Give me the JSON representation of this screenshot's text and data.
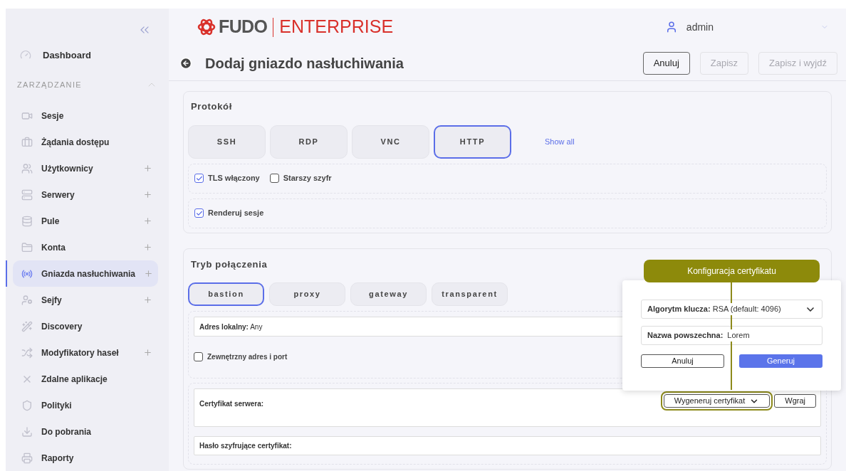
{
  "sidebar": {
    "dashboard": "Dashboard",
    "section": {
      "title": "ZARZĄDZANIE",
      "expanded": true
    },
    "items": [
      {
        "label": "Sesje",
        "addable": false,
        "selected": false
      },
      {
        "label": "Żądania dostępu",
        "addable": false,
        "selected": false
      },
      {
        "label": "Użytkownicy",
        "addable": true,
        "selected": false
      },
      {
        "label": "Serwery",
        "addable": true,
        "selected": false
      },
      {
        "label": "Pule",
        "addable": true,
        "selected": false
      },
      {
        "label": "Konta",
        "addable": true,
        "selected": false
      },
      {
        "label": "Gniazda nasłuchiwania",
        "addable": true,
        "selected": true
      },
      {
        "label": "Sejfy",
        "addable": true,
        "selected": false
      },
      {
        "label": "Discovery",
        "addable": false,
        "selected": false
      },
      {
        "label": "Modyfikatory haseł",
        "addable": true,
        "selected": false
      },
      {
        "label": "Zdalne aplikacje",
        "addable": false,
        "selected": false
      },
      {
        "label": "Polityki",
        "addable": false,
        "selected": false
      },
      {
        "label": "Do pobrania",
        "addable": false,
        "selected": false
      },
      {
        "label": "Raporty",
        "addable": false,
        "selected": false
      }
    ]
  },
  "header": {
    "logo": {
      "brand": "FUDO",
      "product": "ENTERPRISE"
    },
    "user": "admin",
    "title": "Dodaj gniazdo nasłuchiwania",
    "buttons": [
      {
        "label": "Anuluj",
        "disabled": false
      },
      {
        "label": "Zapisz",
        "disabled": true
      },
      {
        "label": "Zapisz i wyjdź",
        "disabled": true
      }
    ]
  },
  "protocol": {
    "title": "Protokół",
    "options": [
      {
        "label": "SSH",
        "selected": false
      },
      {
        "label": "RDP",
        "selected": false
      },
      {
        "label": "VNC",
        "selected": false
      },
      {
        "label": "HTTP",
        "selected": true
      }
    ],
    "show_all": "Show all",
    "checkbox_groups": [
      [
        {
          "label": "TLS włączony",
          "checked": true
        },
        {
          "label": "Starszy szyfr",
          "checked": false
        }
      ],
      [
        {
          "label": "Renderuj sesje",
          "checked": true
        }
      ]
    ]
  },
  "mode": {
    "title": "Tryb połączenia",
    "options": [
      {
        "label": "bastion",
        "selected": true
      },
      {
        "label": "proxy",
        "selected": false
      },
      {
        "label": "gateway",
        "selected": false
      },
      {
        "label": "transparent",
        "selected": false
      }
    ],
    "local_address": {
      "label": "Adres lokalny:",
      "value": "Any"
    },
    "external": {
      "label": "Zewnętrzny adres i port",
      "checked": false
    },
    "certificate": {
      "label": "Certyfikat serwera:",
      "buttons": [
        "Wygeneruj certyfikat",
        "Wgraj"
      ]
    },
    "password": {
      "label": "Hasło szyfrujące certyfikat:"
    }
  },
  "popover": {
    "callout": "Konfiguracja certyfikatu",
    "algorithm": {
      "label": "Algorytm klucza:",
      "value": "RSA (default: 4096)"
    },
    "common_name": {
      "label": "Nazwa powszechna:",
      "value": "Lorem"
    },
    "buttons": [
      {
        "label": "Anuluj",
        "kind": "secondary"
      },
      {
        "label": "Generuj",
        "kind": "primary"
      }
    ]
  }
}
